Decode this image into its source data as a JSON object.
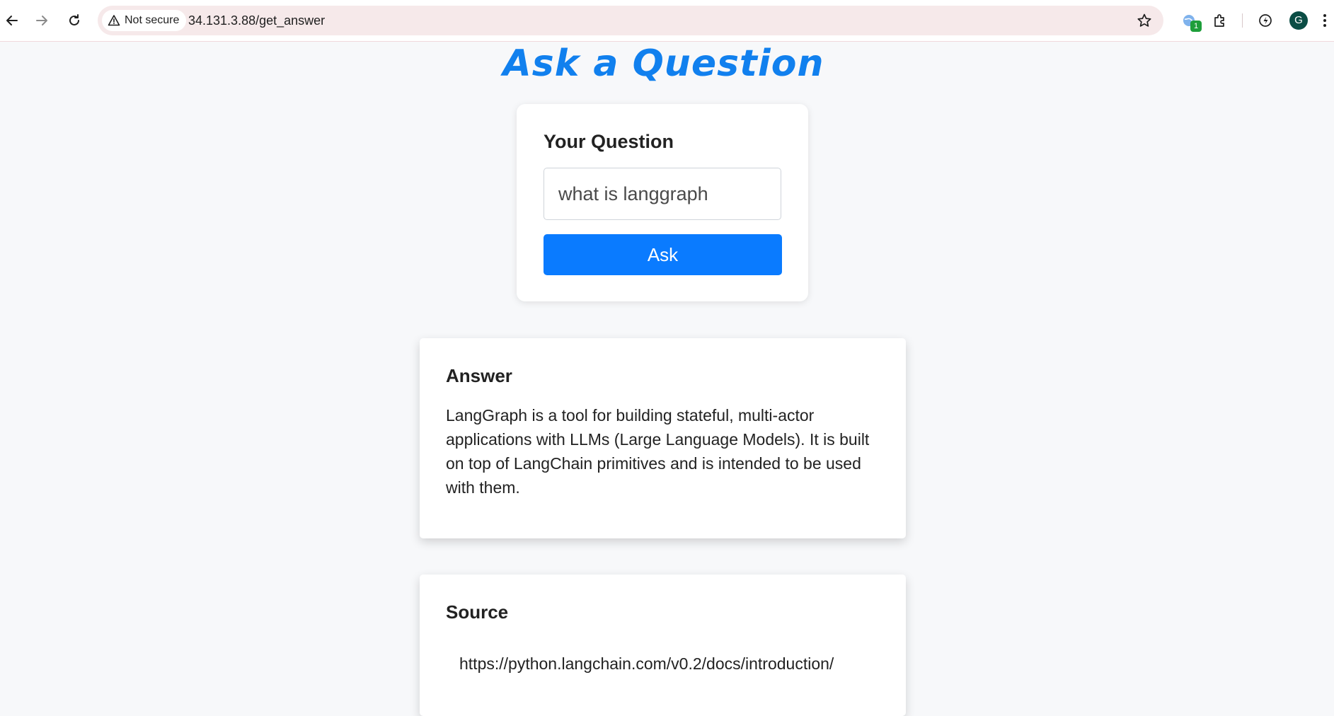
{
  "browser": {
    "security_label": "Not secure",
    "url": "34.131.3.88/get_answer",
    "extension_badge": "1",
    "profile_initial": "G"
  },
  "page": {
    "title": "Ask a Question",
    "question_label": "Your Question",
    "question_value": "what is langgraph",
    "ask_button": "Ask"
  },
  "answer": {
    "heading": "Answer",
    "text": "LangGraph is a tool for building stateful, multi-actor applications with LLMs (Large Language Models). It is built on top of LangChain primitives and is intended to be used with them."
  },
  "source": {
    "heading": "Source",
    "url": "https://python.langchain.com/v0.2/docs/introduction/"
  },
  "colors": {
    "accent": "#0a7bff",
    "title": "#1180ee"
  }
}
